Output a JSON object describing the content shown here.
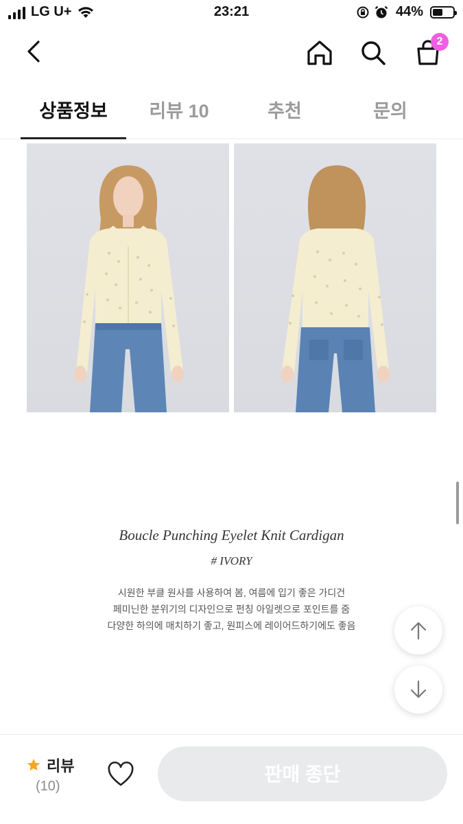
{
  "status_bar": {
    "carrier": "LG U+",
    "time": "23:21",
    "battery_percent": "44%"
  },
  "header": {
    "cart_badge": "2",
    "icons": [
      "back-icon",
      "home-icon",
      "search-icon",
      "shopping-bag-icon"
    ]
  },
  "tabs": [
    {
      "label": "상품정보",
      "active": true
    },
    {
      "label": "리뷰 10",
      "active": false
    },
    {
      "label": "추천",
      "active": false
    },
    {
      "label": "문의",
      "active": false
    }
  ],
  "product": {
    "title": "Boucle Punching Eyelet Knit Cardigan",
    "color": "# IVORY",
    "description": [
      "시원한 부클 원사를 사용하여 봄, 여름에 입기 좋은 가디건",
      "페미닌한 분위기의 디자인으로 펀칭 아일렛으로 포인트를 줌",
      "다양한 하의에 매치하기 좋고, 원피스에 레이어드하기에도 좋음"
    ]
  },
  "bottom_bar": {
    "review_label": "리뷰",
    "review_count": "(10)",
    "action_button": "판매 종단"
  },
  "colors": {
    "badge": "#f05ee1",
    "star": "#f5a623",
    "disabled_button": "#e9eaec"
  }
}
